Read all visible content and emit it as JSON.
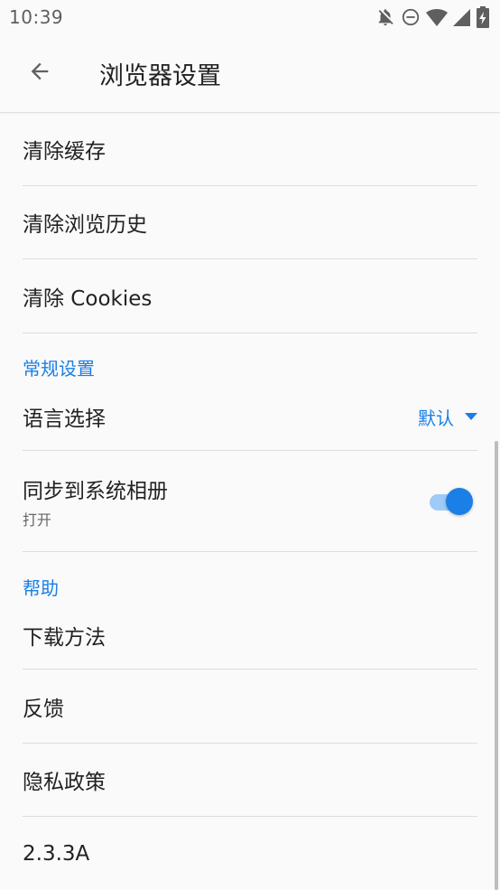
{
  "status_bar": {
    "time": "10:39",
    "icons": [
      "notifications-off-icon",
      "do-not-disturb-icon",
      "wifi-icon",
      "signal-icon",
      "battery-charging-icon"
    ]
  },
  "app_bar": {
    "title": "浏览器设置",
    "back_icon": "arrow-back-icon"
  },
  "items": {
    "clear_cache": "清除缓存",
    "clear_history": "清除浏览历史",
    "clear_cookies": "清除 Cookies"
  },
  "general": {
    "header": "常规设置",
    "language": {
      "label": "语言选择",
      "value": "默认"
    },
    "sync_album": {
      "label": "同步到系统相册",
      "summary": "打开",
      "enabled": true
    }
  },
  "help": {
    "header": "帮助",
    "download_method": "下载方法",
    "feedback": "反馈",
    "privacy_policy": "隐私政策",
    "version": "2.3.3A"
  },
  "colors": {
    "accent": "#1a7fe6",
    "background": "#fafafa",
    "divider": "#dcdcdc"
  }
}
